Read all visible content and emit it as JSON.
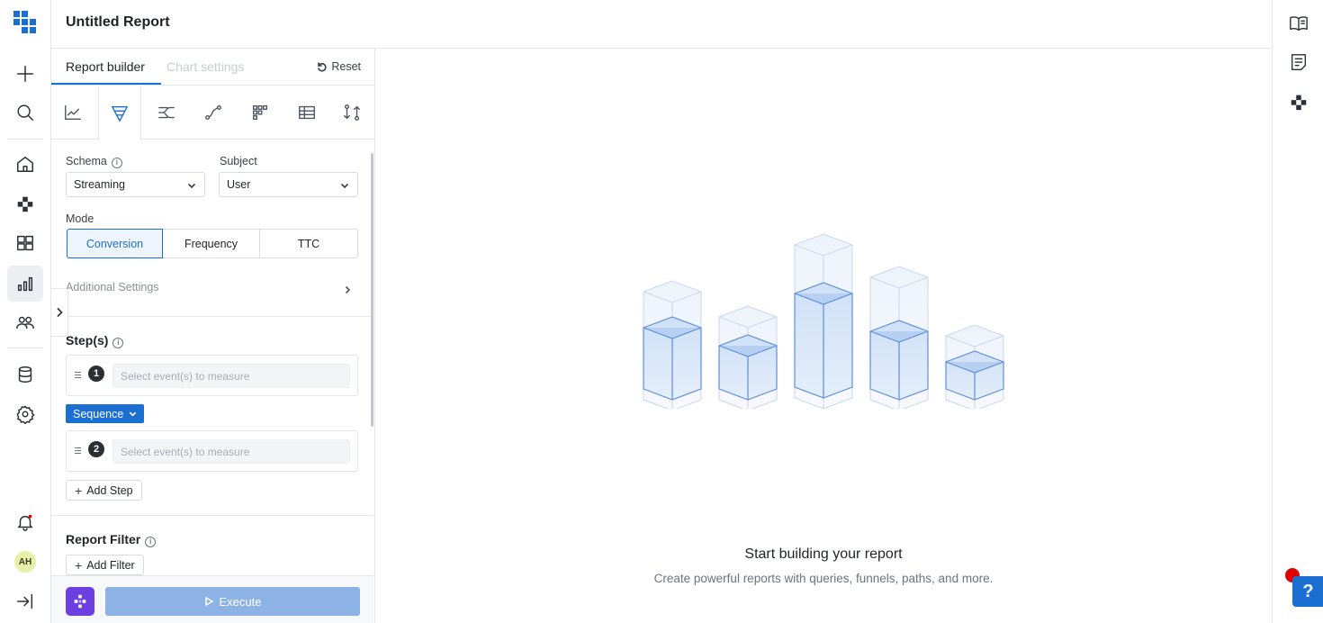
{
  "header": {
    "title": "Untitled Report"
  },
  "nav": {
    "items": [
      "app-grid",
      "new",
      "search",
      "home",
      "integrations",
      "dashboards",
      "reports",
      "audiences",
      "data",
      "settings",
      "notifications",
      "collapse-nav"
    ],
    "avatar_initials": "AH"
  },
  "builder": {
    "tabs": {
      "active": "Report builder",
      "inactive": "Chart settings"
    },
    "reset_label": "Reset",
    "report_types": [
      "trend-chart-icon",
      "funnel-icon",
      "flow-icon",
      "path-icon",
      "heatmap-icon",
      "table-icon",
      "compare-icon"
    ],
    "active_report_type": "funnel-icon",
    "schema": {
      "label": "Schema",
      "value": "Streaming"
    },
    "subject": {
      "label": "Subject",
      "value": "User"
    },
    "mode": {
      "label": "Mode",
      "options": [
        "Conversion",
        "Frequency",
        "TTC"
      ],
      "selected": "Conversion"
    },
    "additional_settings": "Additional Settings",
    "steps": {
      "title": "Step(s)",
      "items": [
        {
          "number": "1",
          "placeholder": "Select event(s) to measure"
        },
        {
          "number": "2",
          "placeholder": "Select event(s) to measure"
        }
      ],
      "connector": "Sequence",
      "add_label": "Add Step"
    },
    "report_filter": {
      "title": "Report Filter",
      "add_label": "Add Filter"
    },
    "execute_label": "Execute"
  },
  "main": {
    "empty_title": "Start building your report",
    "empty_subtitle": "Create powerful reports with queries, funnels, paths, and more."
  },
  "colors": {
    "accent": "#1b6fd1",
    "logo_purple": "#6d3fe0",
    "execute_disabled": "#8db3e6",
    "help_dot": "#e00000"
  }
}
